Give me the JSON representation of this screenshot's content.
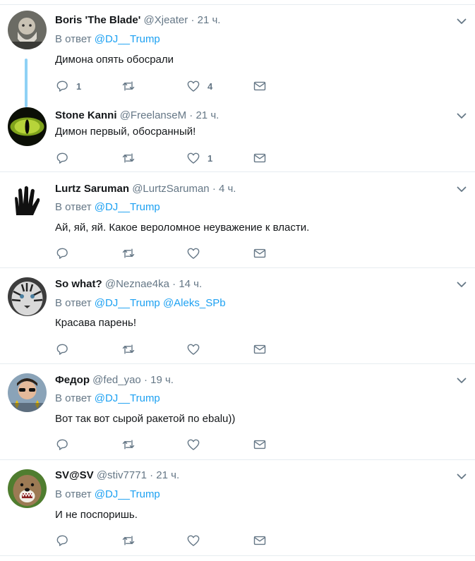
{
  "reply_prefix": "В ответ",
  "separator": "·",
  "icons": {
    "reply": "reply-icon",
    "retweet": "retweet-icon",
    "like": "heart-icon",
    "dm": "envelope-icon",
    "more": "chevron-down-icon"
  },
  "colors": {
    "link": "#1da1f2",
    "muted": "#657786",
    "thread": "#8fd1f5"
  },
  "tweets": [
    {
      "name": "Boris 'The Blade'",
      "handle": "@Xjeater",
      "time": "21 ч.",
      "reply_to": [
        "@DJ__Trump"
      ],
      "text": "Димона опять обосрали",
      "replies": "1",
      "retweets": "",
      "likes": "4"
    },
    {
      "name": "Stone Kanni",
      "handle": "@FreelanseM",
      "time": "21 ч.",
      "reply_to": [],
      "text": "Димон первый, обосранный!",
      "replies": "",
      "retweets": "",
      "likes": "1"
    },
    {
      "name": "Lurtz Saruman",
      "handle": "@LurtzSaruman",
      "time": "4 ч.",
      "reply_to": [
        "@DJ__Trump"
      ],
      "text": "Ай, яй, яй. Какое вероломное неуважение к власти.",
      "replies": "",
      "retweets": "",
      "likes": ""
    },
    {
      "name": "So what?",
      "handle": "@Neznae4ka",
      "time": "14 ч.",
      "reply_to": [
        "@DJ__Trump",
        "@Aleks_SPb"
      ],
      "text": "Красава парень!",
      "replies": "",
      "retweets": "",
      "likes": ""
    },
    {
      "name": "Федор",
      "handle": "@fed_yao",
      "time": "19 ч.",
      "reply_to": [
        "@DJ__Trump"
      ],
      "text": "Вот так вот сырой ракетой по ebalu))",
      "replies": "",
      "retweets": "",
      "likes": ""
    },
    {
      "name": "SV@SV",
      "handle": "@stiv7771",
      "time": "21 ч.",
      "reply_to": [
        "@DJ__Trump"
      ],
      "text": "И не поспоришь.",
      "replies": "",
      "retweets": "",
      "likes": ""
    }
  ]
}
